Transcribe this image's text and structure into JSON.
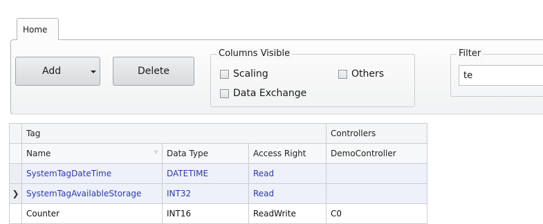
{
  "ribbon": {
    "tabs": [
      {
        "label": "Home",
        "active": true
      }
    ],
    "add_label": "Add",
    "delete_label": "Delete",
    "columns_visible": {
      "title": "Columns Visible",
      "options": [
        {
          "label": "Scaling",
          "checked": false
        },
        {
          "label": "Others",
          "checked": false
        },
        {
          "label": "Data Exchange",
          "checked": false
        }
      ]
    },
    "filter": {
      "title": "Filter",
      "value": "te"
    }
  },
  "grid": {
    "group_headers": {
      "tag": "Tag",
      "controllers": "Controllers"
    },
    "columns": {
      "name": "Name",
      "data_type": "Data Type",
      "access_right": "Access Right",
      "controller": "DemoController"
    },
    "rows": [
      {
        "name": "SystemTagDateTime",
        "data_type": "DATETIME",
        "access_right": "Read",
        "controller": "",
        "current": false
      },
      {
        "name": "SystemTagAvailableStorage",
        "data_type": "INT32",
        "access_right": "Read",
        "controller": "",
        "current": true
      },
      {
        "name": "Counter",
        "data_type": "INT16",
        "access_right": "ReadWrite",
        "controller": "C0",
        "current": false
      }
    ],
    "current_row_indicator": "❯"
  },
  "colors": {
    "system_row_text": "#2b3aa8",
    "system_row_bg": "#eef0fa"
  },
  "icons": {
    "add_dropdown": "chevron-down-icon",
    "column_filter": "funnel-icon",
    "row_indicator": "chevron-right-icon"
  }
}
